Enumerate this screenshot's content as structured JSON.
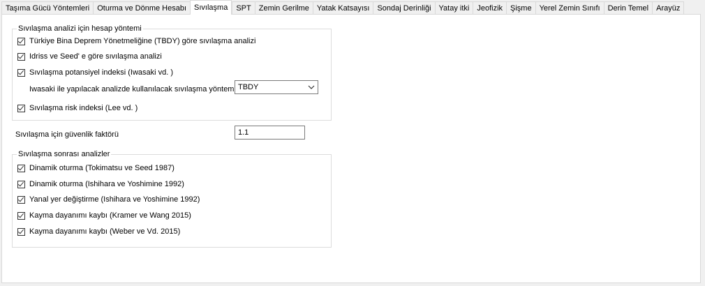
{
  "tabs": [
    {
      "label": "Taşıma Gücü Yöntemleri"
    },
    {
      "label": "Oturma ve Dönme Hesabı"
    },
    {
      "label": "Sıvılaşma"
    },
    {
      "label": "SPT"
    },
    {
      "label": "Zemin Gerilme"
    },
    {
      "label": "Yatak Katsayısı"
    },
    {
      "label": "Sondaj Derinliği"
    },
    {
      "label": "Yatay itki"
    },
    {
      "label": "Jeofizik"
    },
    {
      "label": "Şişme"
    },
    {
      "label": "Yerel Zemin Sınıfı"
    },
    {
      "label": "Derin Temel"
    },
    {
      "label": "Arayüz"
    }
  ],
  "active_tab": "Sıvılaşma",
  "analysis_group": {
    "legend": "Sıvılaşma analizi için hesap yöntemi",
    "items": [
      {
        "label": "Türkiye Bina Deprem Yönetmeliğine (TBDY)  göre sıvılaşma analizi",
        "checked": true
      },
      {
        "label": "Idriss ve Seed' e göre sıvılaşma analizi",
        "checked": true
      },
      {
        "label": "Sıvılaşma potansiyel indeksi (Iwasaki vd. )",
        "checked": true
      },
      {
        "label": "Sıvılaşma risk indeksi (Lee vd. )",
        "checked": true
      }
    ],
    "iwasaki_method_label": "Iwasaki ile yapılacak analizde kullanılacak sıvılaşma yöntemi",
    "iwasaki_method_value": "TBDY"
  },
  "safety_factor": {
    "label": "Sıvılaşma için güvenlik faktörü",
    "value": "1.1"
  },
  "post_group": {
    "legend": "Sıvılaşma sonrası analizler",
    "items": [
      {
        "label": "Dinamik oturma (Tokimatsu ve Seed  1987)",
        "checked": true
      },
      {
        "label": "Dinamik oturma (Ishihara ve Yoshimine 1992)",
        "checked": true
      },
      {
        "label": "Yanal yer değiştirme (Ishihara ve Yoshimine  1992)",
        "checked": true
      },
      {
        "label": "Kayma dayanımı kaybı (Kramer ve Wang 2015)",
        "checked": true
      },
      {
        "label": "Kayma dayanımı kaybı (Weber ve Vd. 2015)",
        "checked": true
      }
    ]
  },
  "icons": {
    "checkbox": "checkmark-icon",
    "dropdown": "chevron-down-icon"
  }
}
